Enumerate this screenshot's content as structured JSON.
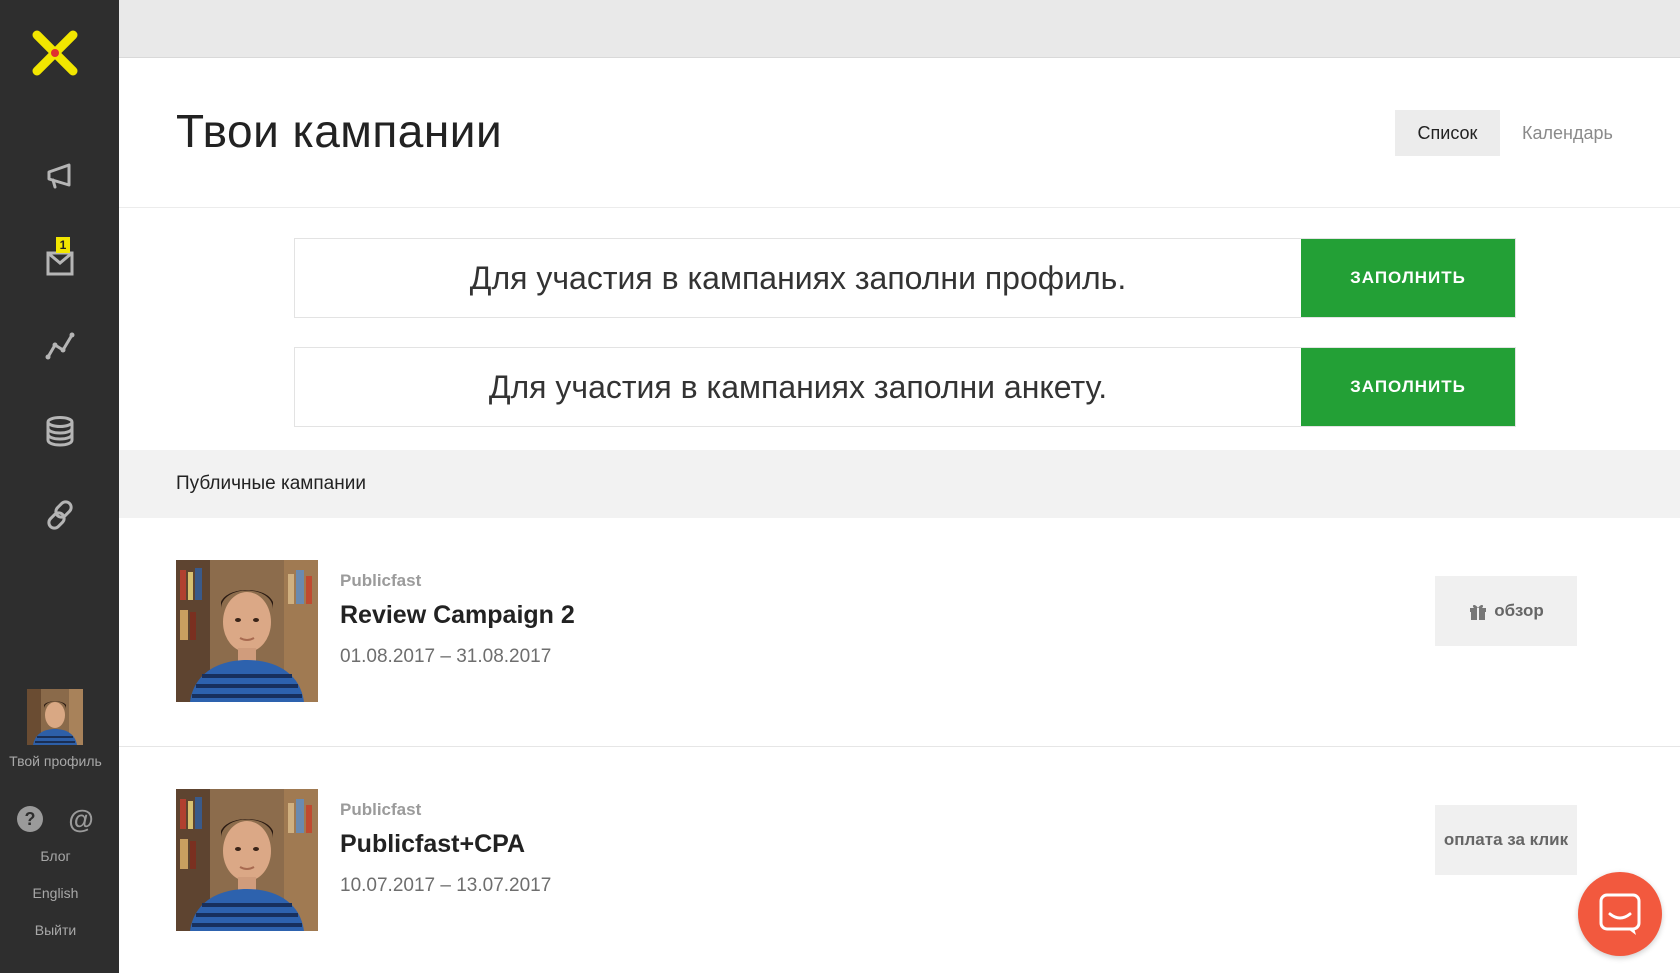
{
  "sidebar": {
    "notification_count": "1",
    "profile_label": "Твой профиль",
    "help_icon_glyph": "?",
    "at_icon_glyph": "@",
    "links": {
      "blog": "Блог",
      "language": "English",
      "logout": "Выйти"
    },
    "icons": [
      "megaphone-icon",
      "inbox-icon",
      "stats-icon",
      "database-icon",
      "link-icon"
    ]
  },
  "header": {
    "title": "Твои кампании",
    "views": {
      "list": "Список",
      "calendar": "Календарь"
    }
  },
  "notices": [
    {
      "text": "Для участия в кампаниях заполни профиль.",
      "button": "ЗАПОЛНИТЬ"
    },
    {
      "text": "Для участия в кампаниях заполни анкету.",
      "button": "ЗАПОЛНИТЬ"
    }
  ],
  "section": {
    "title": "Публичные кампании"
  },
  "campaigns": [
    {
      "brand": "Publicfast",
      "title": "Review Campaign 2",
      "dates": "01.08.2017 – 31.08.2017",
      "tag": "обзор",
      "tag_icon": "gift-icon"
    },
    {
      "brand": "Publicfast",
      "title": "Publicfast+CPA",
      "dates": "10.07.2017 – 13.07.2017",
      "tag": "оплата за клик"
    }
  ],
  "colors": {
    "sidebar": "#2e2e2e",
    "accent_green": "#23a036",
    "logo_yellow": "#f2e600",
    "chat_orange": "#f2593e"
  }
}
